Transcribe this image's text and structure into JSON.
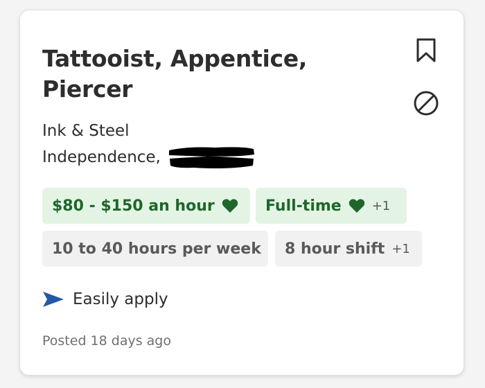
{
  "job": {
    "title_line1": "Tattooist, Appentice,",
    "title_line2": "Piercer",
    "company": "Ink & Steel",
    "location": "Independence,"
  },
  "tags": {
    "pay": "$80 - $150 an hour",
    "job_type": "Full-time",
    "job_type_extra": "+1",
    "hours": "10 to 40 hours per week",
    "shift": "8 hour shift",
    "shift_extra": "+1"
  },
  "apply": {
    "label": "Easily apply"
  },
  "posted": "Posted 18 days ago",
  "colors": {
    "green_bg": "#e4f4e4",
    "green_text": "#1f662c",
    "gray_bg": "#f1f1f1",
    "apply_icon": "#2557a7"
  },
  "icons": {
    "bookmark": "bookmark-icon",
    "block": "block-icon",
    "heart": "heart-icon",
    "apply": "paper-plane-icon"
  }
}
